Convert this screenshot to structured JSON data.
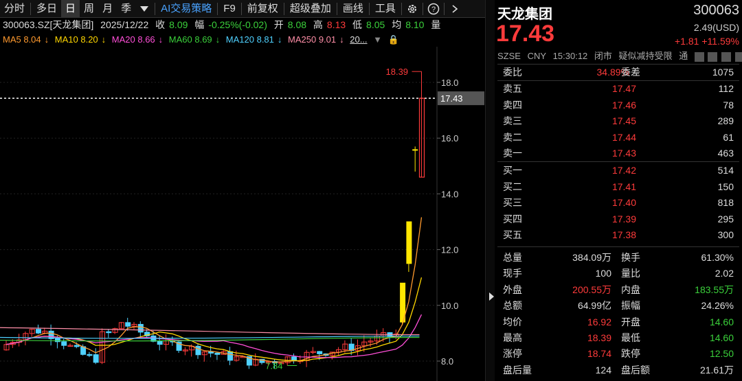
{
  "toolbar": {
    "items": [
      "分时",
      "多日",
      "日",
      "周",
      "月",
      "季"
    ],
    "ai": "AI交易策略",
    "f9": "F9",
    "fq": "前复权",
    "cj": "超级叠加",
    "hx": "画线",
    "gj": "工具"
  },
  "info": {
    "code": "300063.SZ[天龙集团]",
    "date": "2025/12/22",
    "close_label": "收",
    "close": "8.09",
    "amp_label": "幅",
    "amp": "-0.25%(-0.02)",
    "open_label": "开",
    "open": "8.08",
    "high_label": "高",
    "high": "8.13",
    "low_label": "低",
    "low": "8.05",
    "avg_label": "均",
    "avg": "8.10",
    "vol_label": "量"
  },
  "ma": [
    {
      "label": "MA5 8.04",
      "arrow": "↓",
      "color": "#ff9a2e"
    },
    {
      "label": "MA10 8.20",
      "arrow": "↓",
      "color": "#ffd700"
    },
    {
      "label": "MA20 8.66",
      "arrow": "↓",
      "color": "#ff4fd8"
    },
    {
      "label": "MA60 8.69",
      "arrow": "↓",
      "color": "#3bd13b"
    },
    {
      "label": "MA120 8.81",
      "arrow": "↓",
      "color": "#4fd1ff"
    },
    {
      "label": "MA250 9.01",
      "arrow": "↓",
      "color": "#ff8fa8"
    }
  ],
  "ma_more": "20...",
  "chart_data": {
    "type": "candlestick",
    "ylim": [
      7.6,
      19.0
    ],
    "yticks": [
      "18.0",
      "16.0",
      "14.0",
      "12.0",
      "10.0",
      "8.0"
    ],
    "current": "17.43",
    "current_value": 17.43,
    "high_label": "18.39",
    "high_value": 18.39,
    "low_label": "7.84",
    "low_value": 7.84
  },
  "quote": {
    "name": "天龙集团",
    "code": "300063",
    "price": "17.43",
    "usd": "2.49(USD)",
    "chg": "+1.81",
    "pct": "+11.59%",
    "exch": "SZSE",
    "cur": "CNY",
    "time": "15:30:12",
    "status": "闭市",
    "note": "疑似减持受限",
    "tong": "通"
  },
  "weibi": {
    "l1": "委比",
    "v1": "34.89%",
    "l2": "委差",
    "v2": "1075"
  },
  "asks": [
    {
      "l": "卖五",
      "p": "17.47",
      "v": "112"
    },
    {
      "l": "卖四",
      "p": "17.46",
      "v": "78"
    },
    {
      "l": "卖三",
      "p": "17.45",
      "v": "289"
    },
    {
      "l": "卖二",
      "p": "17.44",
      "v": "61"
    },
    {
      "l": "卖一",
      "p": "17.43",
      "v": "463"
    }
  ],
  "bids": [
    {
      "l": "买一",
      "p": "17.42",
      "v": "514"
    },
    {
      "l": "买二",
      "p": "17.41",
      "v": "150"
    },
    {
      "l": "买三",
      "p": "17.40",
      "v": "818"
    },
    {
      "l": "买四",
      "p": "17.39",
      "v": "295"
    },
    {
      "l": "买五",
      "p": "17.38",
      "v": "300"
    }
  ],
  "stats": [
    {
      "l1": "总量",
      "v1": "384.09万",
      "c1": "wh",
      "l2": "换手",
      "v2": "61.30%",
      "c2": "wh"
    },
    {
      "l1": "现手",
      "v1": "100",
      "c1": "wh",
      "l2": "量比",
      "v2": "2.02",
      "c2": "wh"
    },
    {
      "l1": "外盘",
      "v1": "200.55万",
      "c1": "up",
      "l2": "内盘",
      "v2": "183.55万",
      "c2": "dn"
    },
    {
      "l1": "总额",
      "v1": "64.99亿",
      "c1": "wh",
      "l2": "振幅",
      "v2": "24.26%",
      "c2": "wh"
    },
    {
      "l1": "均价",
      "v1": "16.92",
      "c1": "up",
      "l2": "开盘",
      "v2": "14.60",
      "c2": "dn"
    },
    {
      "l1": "最高",
      "v1": "18.39",
      "c1": "up",
      "l2": "最低",
      "v2": "14.60",
      "c2": "dn"
    },
    {
      "l1": "涨停",
      "v1": "18.74",
      "c1": "up",
      "l2": "跌停",
      "v2": "12.50",
      "c2": "dn"
    },
    {
      "l1": "盘后量",
      "v1": "124",
      "c1": "wh",
      "l2": "盘后额",
      "v2": "21.61万",
      "c2": "wh"
    }
  ]
}
